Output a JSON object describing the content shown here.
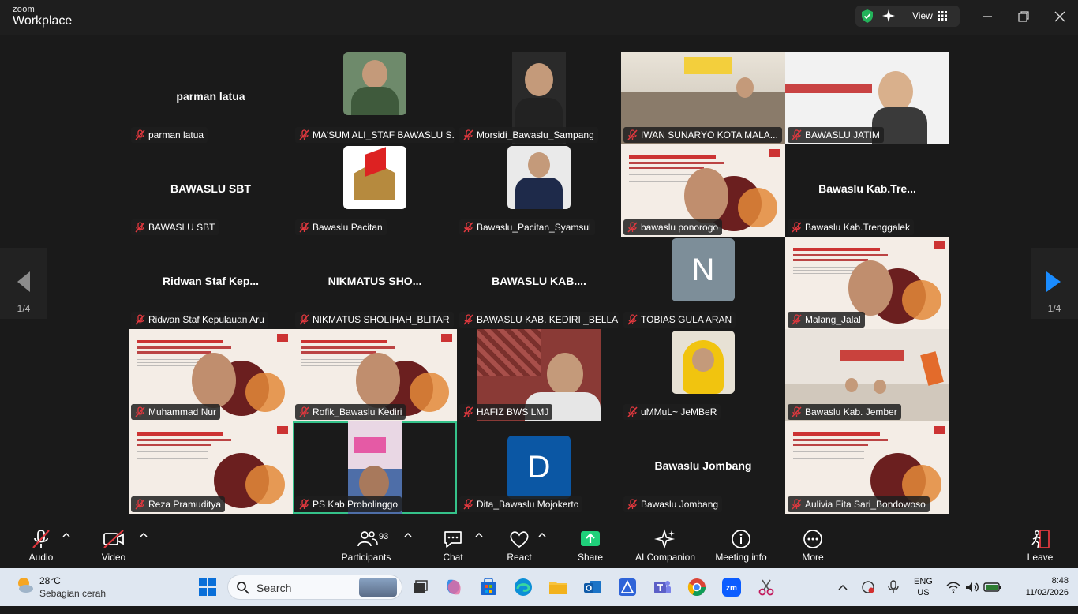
{
  "titlebar": {
    "brand_top": "zoom",
    "brand_bottom": "Workplace",
    "view_label": "View"
  },
  "pager": {
    "left": "1/4",
    "right": "1/4"
  },
  "tiles": [
    {
      "big": "parman latua",
      "label": "parman latua"
    },
    {
      "big": "",
      "label": "MA'SUM ALI_STAF BAWASLU S..."
    },
    {
      "big": "",
      "label": "Morsidi_Bawaslu_Sampang"
    },
    {
      "big": "",
      "label": "IWAN SUNARYO KOTA MALA..."
    },
    {
      "big": "",
      "label": "BAWASLU JATIM"
    },
    {
      "big": "BAWASLU SBT",
      "label": "BAWASLU SBT"
    },
    {
      "big": "",
      "label": "Bawaslu Pacitan"
    },
    {
      "big": "",
      "label": "Bawaslu_Pacitan_Syamsul"
    },
    {
      "big": "",
      "label": "bawaslu ponorogo"
    },
    {
      "big": "Bawaslu  Kab.Tre...",
      "label": "Bawaslu Kab.Trenggalek"
    },
    {
      "big": "Ridwan  Staf  Kep...",
      "label": "Ridwan Staf Kepulauan Aru"
    },
    {
      "big": "NIKMATUS  SHO...",
      "label": "NIKMATUS SHOLIHAH_BLITAR"
    },
    {
      "big": "BAWASLU  KAB....",
      "label": "BAWASLU KAB. KEDIRI _BELLA"
    },
    {
      "big": "",
      "label": "TOBIAS GULA ARAN",
      "avatar": "N"
    },
    {
      "big": "",
      "label": "Malang_Jalal"
    },
    {
      "big": "",
      "label": "Muhammad Nur"
    },
    {
      "big": "",
      "label": "Rofik_Bawaslu Kediri"
    },
    {
      "big": "",
      "label": "HAFIZ BWS LMJ"
    },
    {
      "big": "",
      "label": "uMMuL~ JeMBeR"
    },
    {
      "big": "",
      "label": "Bawaslu Kab. Jember"
    },
    {
      "big": "",
      "label": "Reza Pramuditya"
    },
    {
      "big": "",
      "label": "PS Kab Probolinggo"
    },
    {
      "big": "",
      "label": "Dita_Bawaslu Mojokerto",
      "avatar": "D"
    },
    {
      "big": "Bawaslu Jombang",
      "label": "Bawaslu Jombang"
    },
    {
      "big": "",
      "label": "Aulivia Fita Sari_Bondowoso"
    }
  ],
  "toolbar": {
    "audio": "Audio",
    "video": "Video",
    "participants": "Participants",
    "participant_count": "93",
    "chat": "Chat",
    "react": "React",
    "share": "Share",
    "ai": "AI Companion",
    "info": "Meeting info",
    "more": "More",
    "leave": "Leave"
  },
  "taskbar": {
    "temp": "28°C",
    "condition": "Sebagian cerah",
    "search": "Search",
    "lang_top": "ENG",
    "lang_bottom": "US",
    "time": "8:48",
    "date": "11/02/2026"
  },
  "colors": {
    "accent_green": "#35c28a",
    "leave_red": "#e0383e",
    "share_green": "#1fd07a"
  }
}
